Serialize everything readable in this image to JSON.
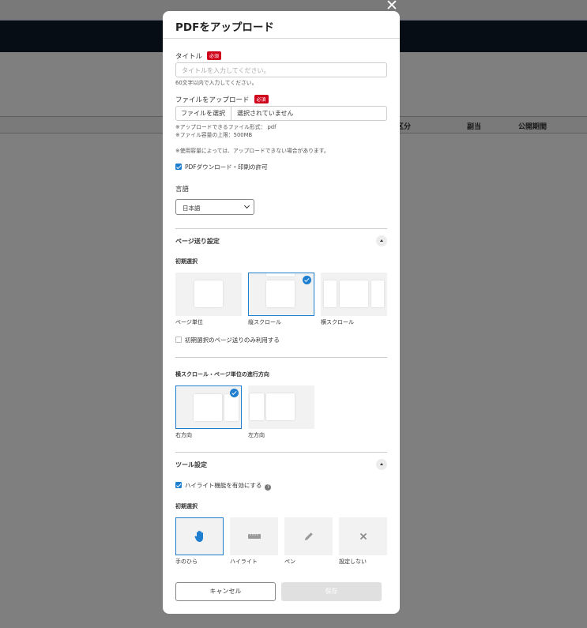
{
  "background": {
    "columns": [
      "区分",
      "副当",
      "公開期間"
    ]
  },
  "modal": {
    "title": "PDFをアップロード",
    "title_field": {
      "label": "タイトル",
      "required": "必須",
      "placeholder": "タイトルを入力してください。",
      "note": "60文字以内で入力してください。"
    },
    "file_field": {
      "label": "ファイルをアップロード",
      "required": "必須",
      "button": "ファイルを選択",
      "status": "選択されていません",
      "notes": [
        "※アップロードできるファイル形式： pdf",
        "※ファイル容量の上限：500MB"
      ],
      "warning": "※使用容量によっては、アップロードできない場合があります。"
    },
    "download_permission": {
      "label": "PDFダウンロード・印刷の許可",
      "checked": true
    },
    "language": {
      "label": "言語",
      "selected": "日本語"
    },
    "page_turn": {
      "title": "ページ送り設定",
      "initial_label": "初期選択",
      "options": [
        {
          "label": "ページ単位",
          "selected": false
        },
        {
          "label": "縦スクロール",
          "selected": true
        },
        {
          "label": "横スクロール",
          "selected": false
        }
      ],
      "only_initial": {
        "label": "初期選択のページ送りのみ利用する",
        "checked": false
      }
    },
    "direction": {
      "title": "横スクロール・ページ単位の進行方向",
      "options": [
        {
          "label": "右方向",
          "selected": true
        },
        {
          "label": "左方向",
          "selected": false
        }
      ]
    },
    "tools": {
      "title": "ツール設定",
      "highlight_enable": {
        "label": "ハイライト機能を有効にする",
        "checked": true
      },
      "initial_label": "初期選択",
      "options": [
        {
          "label": "手のひら",
          "icon": "hand-icon",
          "selected": true
        },
        {
          "label": "ハイライト",
          "icon": "highlighter-icon",
          "selected": false
        },
        {
          "label": "ペン",
          "icon": "pen-icon",
          "selected": false
        },
        {
          "label": "設定しない",
          "icon": "x-icon",
          "selected": false
        }
      ]
    },
    "buttons": {
      "cancel": "キャンセル",
      "save": "保存"
    }
  },
  "colors": {
    "accent": "#1e7ecf",
    "required": "#d0021b",
    "header": "#0d1b2a"
  }
}
